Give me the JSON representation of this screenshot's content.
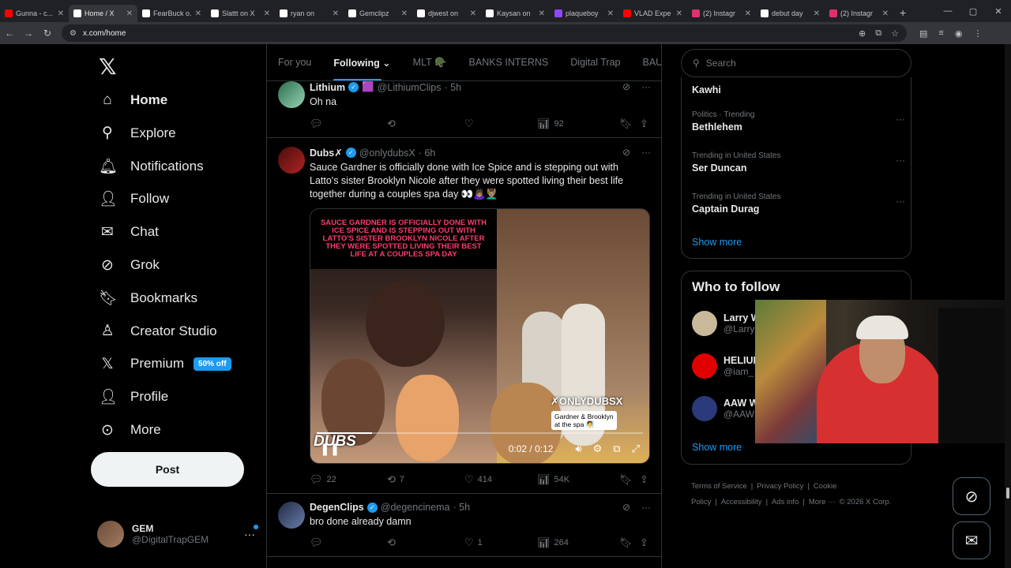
{
  "browser": {
    "tabs": [
      {
        "label": "Gunna - c...",
        "color": "#ff0000"
      },
      {
        "label": "Home / X",
        "color": "#ffffff"
      },
      {
        "label": "FearBuck o...",
        "color": "#ffffff"
      },
      {
        "label": "Slattt on X",
        "color": "#ffffff"
      },
      {
        "label": "ryan on",
        "color": "#ffffff"
      },
      {
        "label": "Gemclipz",
        "color": "#ffffff"
      },
      {
        "label": "djwest on",
        "color": "#ffffff"
      },
      {
        "label": "Kaysan on",
        "color": "#ffffff"
      },
      {
        "label": "plaqueboy",
        "color": "#9147ff"
      },
      {
        "label": "VLAD Expe",
        "color": "#ff0000"
      },
      {
        "label": "(2) Instagr",
        "color": "#e1306c"
      },
      {
        "label": "debut day",
        "color": "#ffffff"
      },
      {
        "label": "(2) Instagr",
        "color": "#e1306c"
      }
    ],
    "url": "x.com/home"
  },
  "sidebar": {
    "items": [
      {
        "label": "Home",
        "icon": "home-icon",
        "glyph": "⌂"
      },
      {
        "label": "Explore",
        "icon": "search-icon",
        "glyph": "⚲"
      },
      {
        "label": "Notifications",
        "icon": "bell-icon",
        "glyph": "🔔︎"
      },
      {
        "label": "Follow",
        "icon": "add-person-icon",
        "glyph": "👤︎"
      },
      {
        "label": "Chat",
        "icon": "mail-icon",
        "glyph": "✉"
      },
      {
        "label": "Grok",
        "icon": "grok-icon",
        "glyph": "⊘"
      },
      {
        "label": "Bookmarks",
        "icon": "bookmark-icon",
        "glyph": "🔖︎"
      },
      {
        "label": "Creator Studio",
        "icon": "creator-icon",
        "glyph": "♙"
      },
      {
        "label": "Premium",
        "icon": "x-premium-icon",
        "glyph": "𝕏"
      },
      {
        "label": "Profile",
        "icon": "profile-icon",
        "glyph": "👤︎"
      },
      {
        "label": "More",
        "icon": "more-icon",
        "glyph": "⊙"
      }
    ],
    "premium_badge": "50% off",
    "post_label": "Post",
    "account": {
      "name": "GEM",
      "handle": "@DigitalTrapGEM"
    }
  },
  "main": {
    "tabs": [
      "For you",
      "Following ⌄",
      "MLT 🪖",
      "BANKS INTERNS",
      "Digital Trap",
      "BAU"
    ],
    "tweets": [
      {
        "name": "Lithium",
        "badge": "🟪",
        "handle": "@LithiumClips",
        "time": "· 5h",
        "text": "Oh na",
        "replies": "",
        "reposts": "",
        "likes": "",
        "views": "92"
      },
      {
        "name": "Dubs✗",
        "badge": "",
        "handle": "@onlydubsX",
        "time": "· 6h",
        "text": "Sauce Gardner is officially done with Ice Spice and is stepping out with Latto's sister Brooklyn Nicole after they were spotted living their best life together during a couples spa day 👀🙇🏽‍♀️💆🏽‍♂️",
        "replies": "22",
        "reposts": "7",
        "likes": "414",
        "views": "54K",
        "media": {
          "caption": "SAUCE GARDNER IS OFFICIALLY DONE WITH ICE SPICE AND IS STEPPING OUT WITH LATTO'S SISTER BROOKLYN NICOLE AFTER THEY WERE SPOTTED LIVING THEIR BEST LIFE AT A COUPLES SPA DAY",
          "watermark": "✗ONLYDUBSX",
          "subtitle_1": "Gardner & Brooklyn",
          "subtitle_2": "at the spa 🧖",
          "logo": "DUBS",
          "time": "0:02 / 0:12",
          "progress": 0.17
        }
      },
      {
        "name": "DegenClips",
        "badge": "",
        "handle": "@degencinema",
        "time": "· 5h",
        "text": "bro done already damn",
        "replies": "",
        "reposts": "",
        "likes": "1",
        "views": "264"
      }
    ]
  },
  "right": {
    "search_placeholder": "Search",
    "trends": [
      {
        "meta": "",
        "title": "Kawhi"
      },
      {
        "meta": "Politics · Trending",
        "title": "Bethlehem"
      },
      {
        "meta": "Trending in United States",
        "title": "Ser Duncan"
      },
      {
        "meta": "Trending in United States",
        "title": "Captain Durag"
      }
    ],
    "show_more": "Show more",
    "who_to_follow_title": "Who to follow",
    "follow": [
      {
        "name": "Larry W",
        "handle": "@Larry",
        "color": "#c9b89a"
      },
      {
        "name": "HELIUM",
        "handle": "@iam_",
        "color": "#e00000"
      },
      {
        "name": "AAW W",
        "handle": "@AAW",
        "color": "#2a3a7a"
      }
    ],
    "footer": [
      "Terms of Service",
      "|",
      "Privacy Policy",
      "|",
      "Cookie Policy",
      "|",
      "Accessibility",
      "|",
      "Ads info",
      "|",
      "More ···",
      "© 2026 X Corp."
    ]
  },
  "colors": {
    "accent": "#1d9bf0",
    "background": "#000000",
    "border": "#2f3336"
  }
}
